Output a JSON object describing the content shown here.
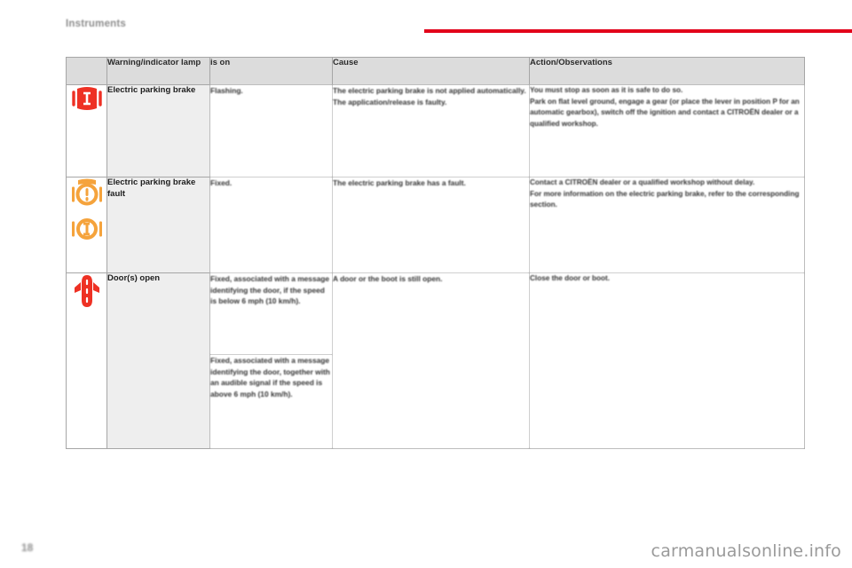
{
  "header": {
    "section_title": "Instruments",
    "rule_color": "#e2001a"
  },
  "table": {
    "columns": [
      {
        "key": "lamp",
        "label": "Warning/indicator lamp"
      },
      {
        "key": "is_on",
        "label": "is on"
      },
      {
        "key": "cause",
        "label": "Cause"
      },
      {
        "key": "action",
        "label": "Action/Observations"
      }
    ],
    "rows": [
      {
        "icons": [
          {
            "name": "electric-parking-brake-icon",
            "color": "#ee3124",
            "glyph": "(P)"
          }
        ],
        "lamp": "Electric parking brake",
        "is_on": "Flashing.",
        "cause": "The electric parking brake is not applied automatically.\nThe application/release is faulty.",
        "action": "You must stop as soon as it is safe to do so.\nPark on flat level ground, engage a gear (or place the lever in position P for an automatic gearbox), switch off the ignition and contact a CITROËN dealer or a qualified workshop."
      },
      {
        "icons": [
          {
            "name": "brake-fault-icon",
            "color": "#f5a33c",
            "glyph": "(!)"
          },
          {
            "name": "parking-brake-fault-icon",
            "color": "#f5a33c",
            "glyph": "(P)"
          }
        ],
        "lamp": "Electric parking brake fault",
        "is_on": "Fixed.",
        "cause": "The electric parking brake has a fault.",
        "action": "Contact a CITROËN dealer or a qualified workshop without delay.\nFor more information on the electric parking brake, refer to the corresponding section."
      },
      {
        "icons": [
          {
            "name": "doors-open-icon",
            "color": "#ee3124",
            "glyph": "car"
          }
        ],
        "lamp": "Door(s) open",
        "is_on": "Fixed, associated with a message identifying the door, if the speed is below 6 mph (10 km/h).",
        "is_on_2": "Fixed, associated with a message identifying the door, together with an audible signal if the speed is above 6 mph (10 km/h).",
        "cause": "A door or the boot is still open.",
        "action": "Close the door or boot."
      }
    ]
  },
  "footer": {
    "page_number": "18",
    "watermark": "carmanualsonline.info"
  }
}
